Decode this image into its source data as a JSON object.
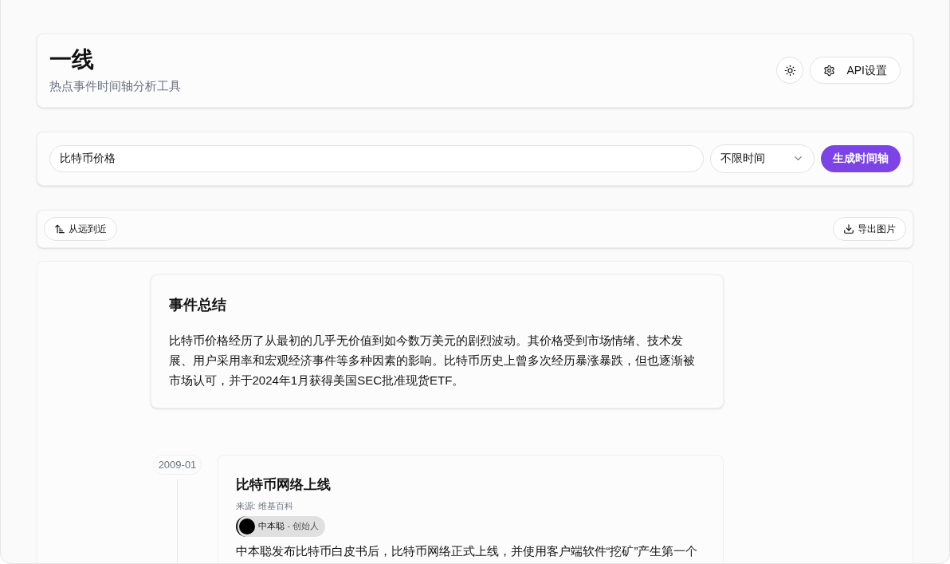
{
  "header": {
    "title": "一线",
    "subtitle": "热点事件时间轴分析工具",
    "api_button": "API设置"
  },
  "search": {
    "value": "比特币价格",
    "time_range": "不限时间",
    "generate_button": "生成时间轴"
  },
  "toolbar": {
    "sort_button": "从远到近",
    "export_button": "导出图片"
  },
  "summary": {
    "title": "事件总结",
    "text": "比特币价格经历了从最初的几乎无价值到如今数万美元的剧烈波动。其价格受到市场情绪、技术发展、用户采用率和宏观经济事件等多种因素的影响。比特币历史上曾多次经历暴涨暴跌，但也逐渐被市场认可，并于2024年1月获得美国SEC批准现货ETF。"
  },
  "events": [
    {
      "date": "2009-01",
      "title": "比特币网络上线",
      "source": "来源: 维基百科",
      "people": [
        {
          "name": "中本聪",
          "role": "- 创始人"
        }
      ],
      "text": "中本聪发布比特币白皮书后，比特币网络正式上线，并使用客户端软件“挖矿”产生第一个"
    }
  ]
}
